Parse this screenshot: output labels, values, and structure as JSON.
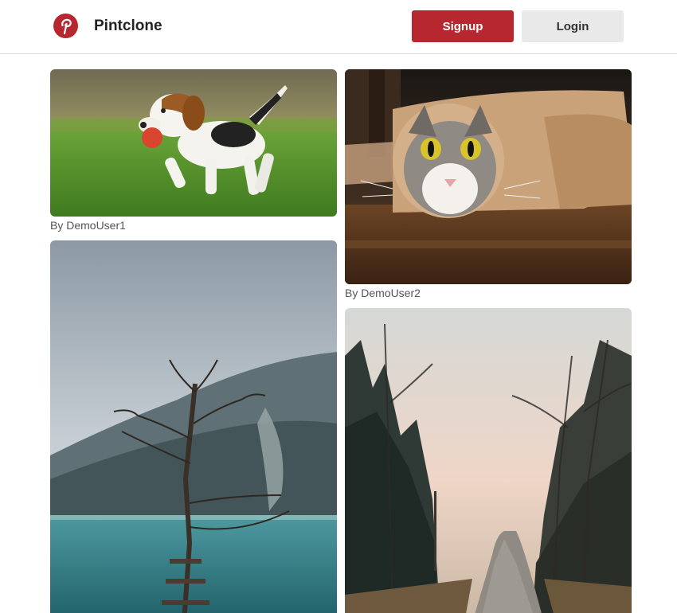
{
  "header": {
    "brand": "Pintclone",
    "logo_icon": "pinterest-p-icon",
    "signup_label": "Signup",
    "login_label": "Login",
    "accent_color": "#b7272f"
  },
  "pins": [
    {
      "image": "beagle-puppy-with-ball",
      "author": "By DemoUser1"
    },
    {
      "image": "cat-in-paper-roll",
      "author": "By DemoUser2"
    },
    {
      "image": "tree-by-mountain-lake",
      "author": ""
    },
    {
      "image": "forest-road-misty",
      "author": ""
    }
  ]
}
